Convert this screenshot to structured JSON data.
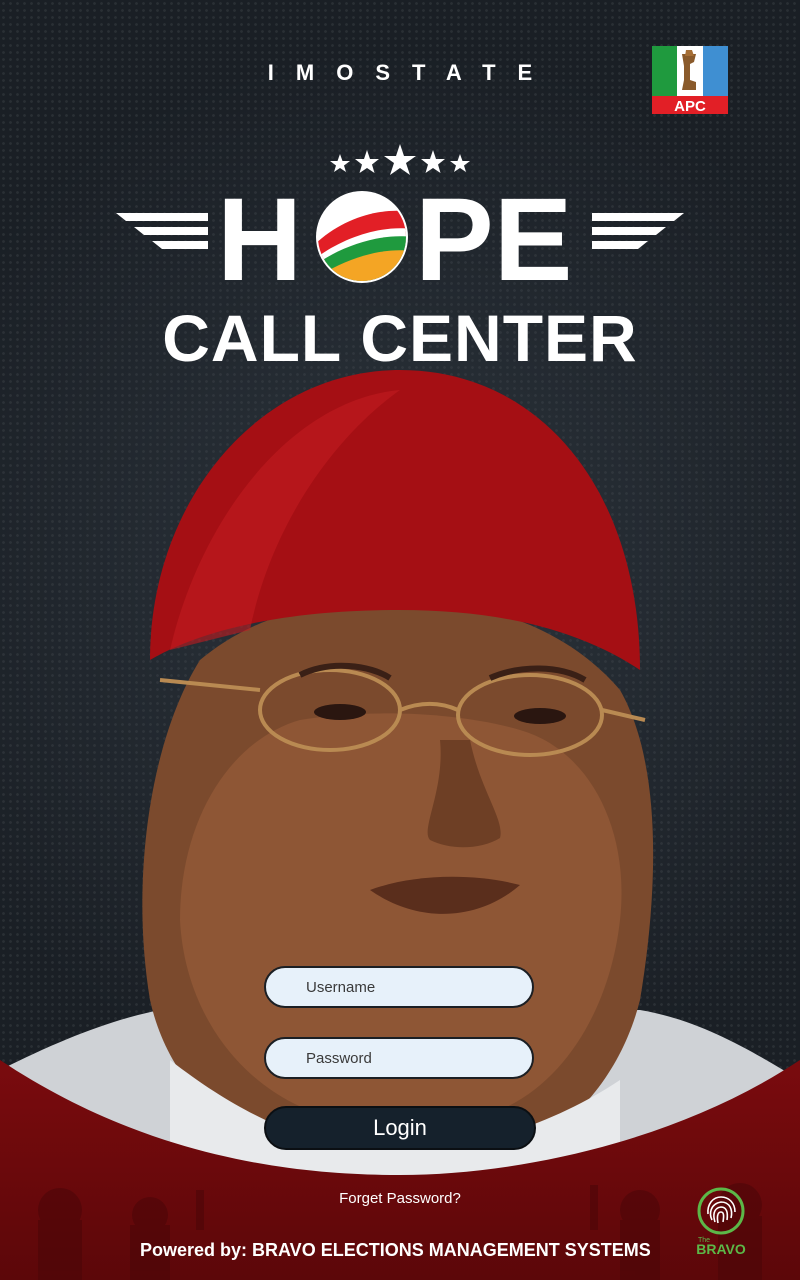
{
  "header": {
    "state_title": "IMOSTATE",
    "party_logo_text": "APC"
  },
  "brand": {
    "hope_text": "HOPE",
    "subtitle": "CALL CENTER"
  },
  "login_form": {
    "username_placeholder": "Username",
    "password_placeholder": "Password",
    "login_label": "Login",
    "forgot_password": "Forget Password?"
  },
  "footer": {
    "powered_by": "Powered by: BRAVO ELECTIONS MANAGEMENT SYSTEMS",
    "bravo_logo_top": "The",
    "bravo_logo_text": "BRAVO"
  },
  "icons": {
    "party_logo": "apc-logo-icon",
    "stars": "stars-icon",
    "fingerprint": "fingerprint-icon"
  },
  "colors": {
    "background": "#1a1f25",
    "band_red": "#8b0f12",
    "field_bg": "#e7f1fa",
    "button_bg": "#15212c",
    "apc_green": "#1f9a3e",
    "apc_red": "#e21f26",
    "apc_blue": "#3f8fd2"
  }
}
